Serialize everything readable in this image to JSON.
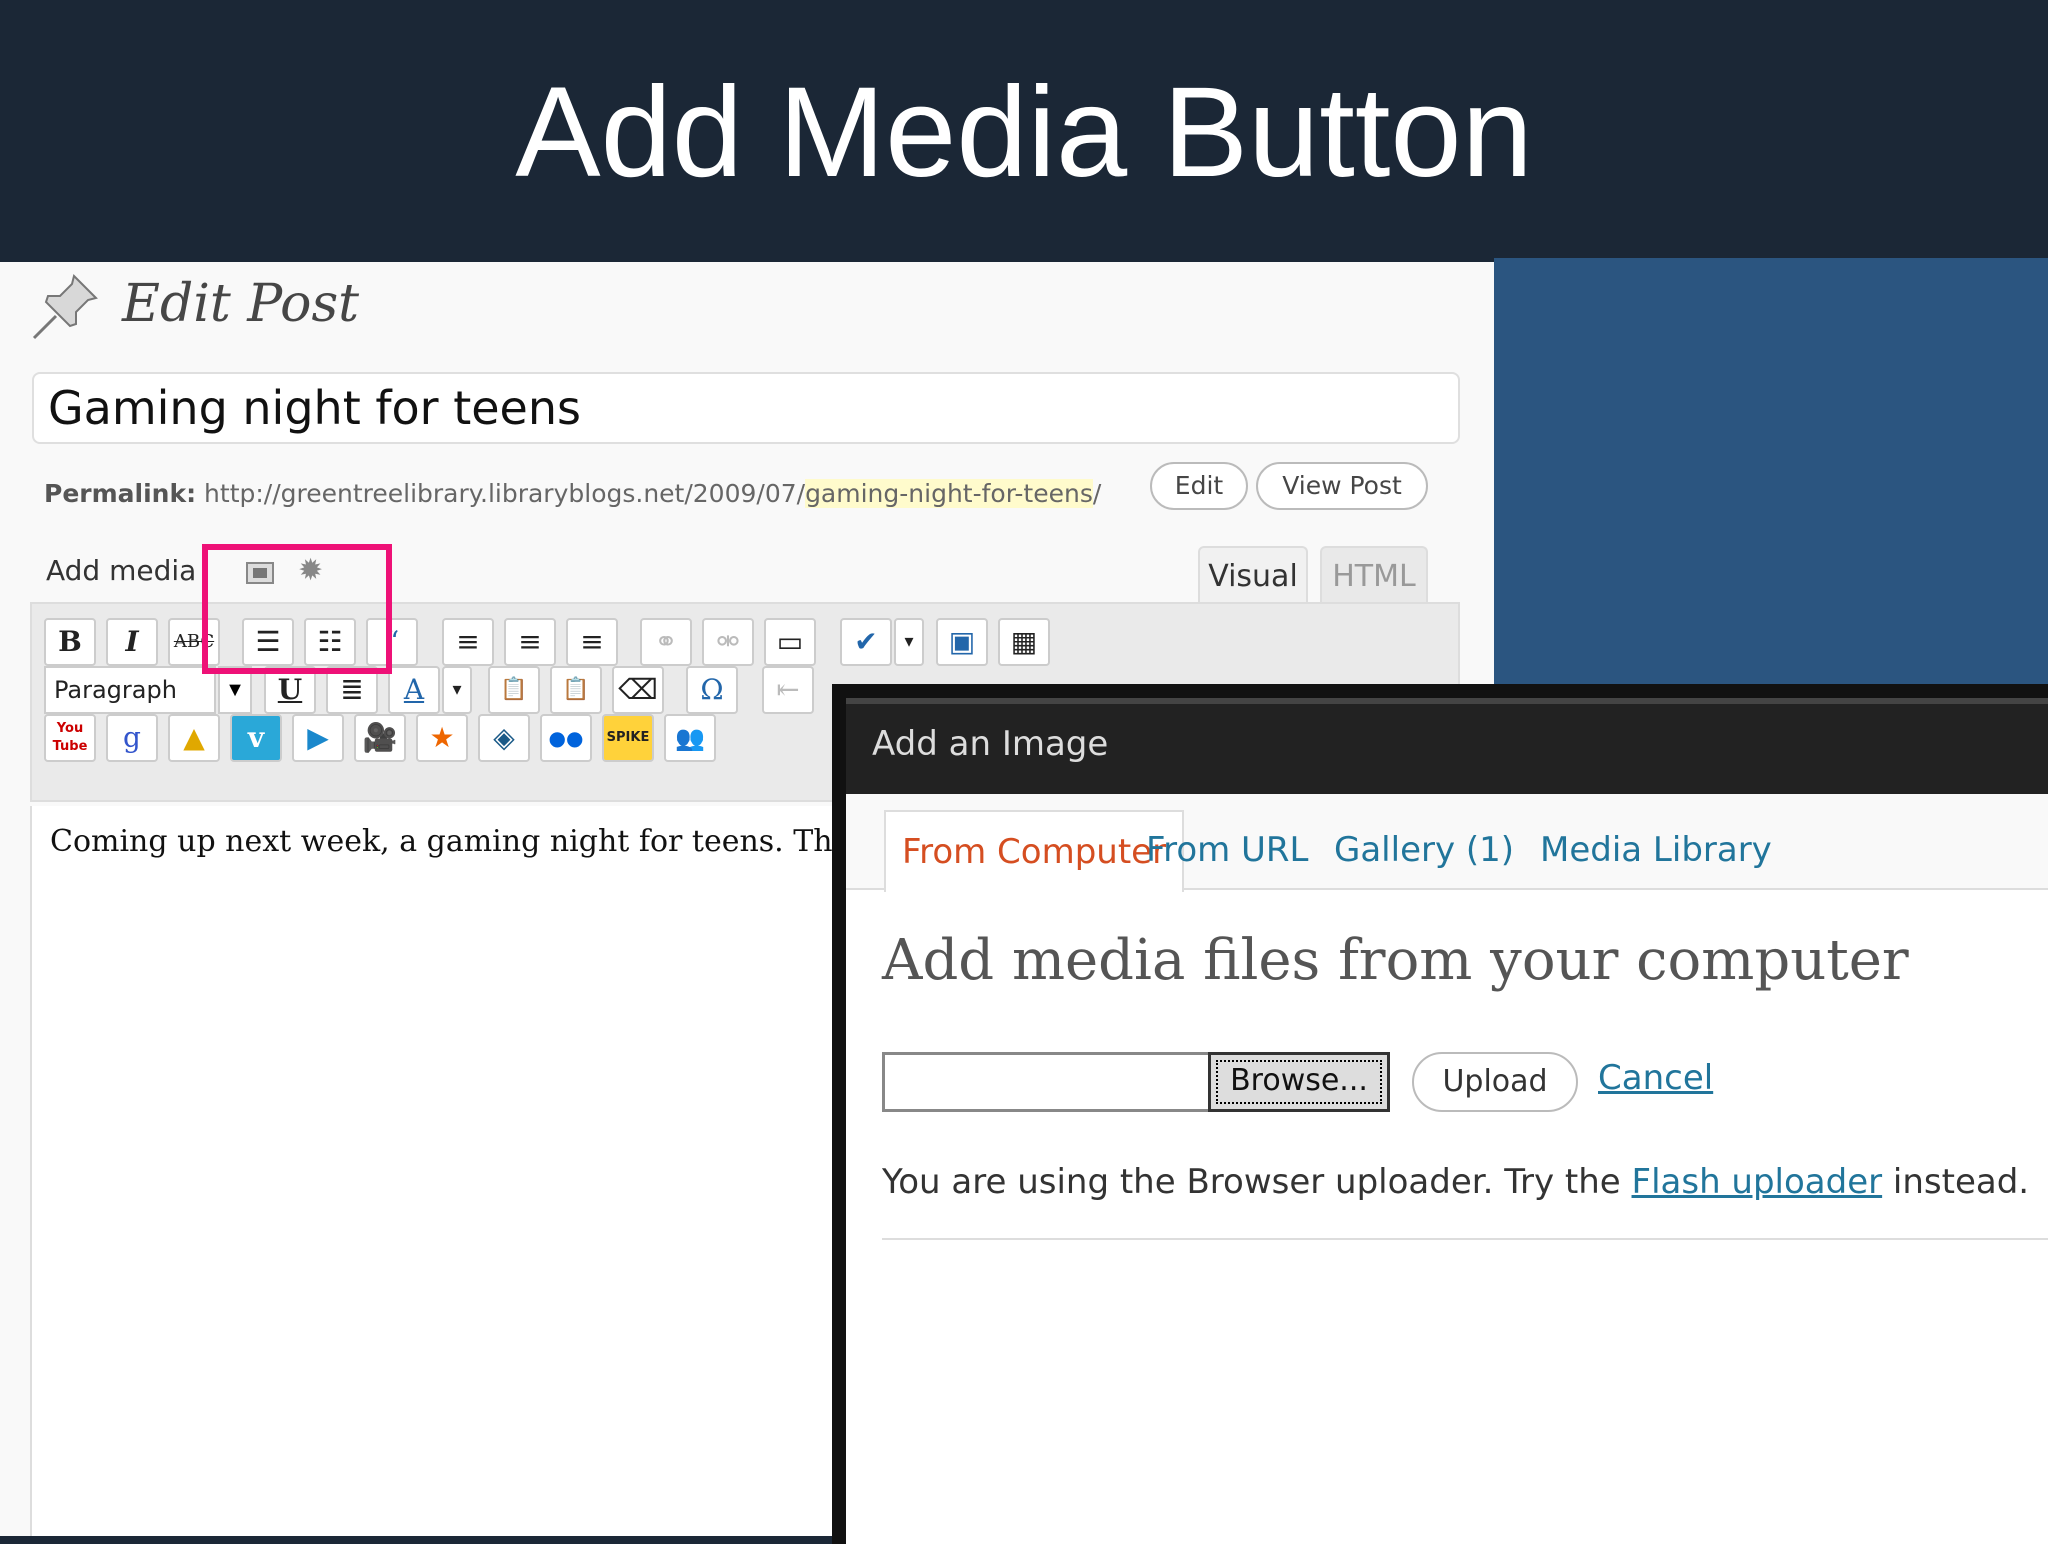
{
  "slide": {
    "title": "Add Media Button"
  },
  "editor": {
    "heading": "Edit Post",
    "post_title": "Gaming night for teens",
    "permalink_label": "Permalink:",
    "permalink_base": "http://greentreelibrary.libraryblogs.net/2009/07/",
    "permalink_slug": "gaming-night-for-teens",
    "permalink_end": "/",
    "edit_button": "Edit",
    "view_post_button": "View Post",
    "add_media_label": "Add media",
    "tab_visual": "Visual",
    "tab_html": "HTML",
    "format_select": "Paragraph",
    "body_text": "Coming up next week, a gaming night for teens. Thursday",
    "toolbar_row1": [
      "B",
      "I",
      "ABC",
      "☰",
      "☷",
      "“",
      "≡",
      "≡",
      "≡",
      "⚭",
      "⚮",
      "▭",
      "✔",
      "▾",
      "▣",
      "▦"
    ],
    "toolbar_row2": [
      "U",
      "≣",
      "A",
      "▾",
      "📋",
      "📋",
      "⌫",
      "Ω",
      "⇤"
    ],
    "toolbar_row3": [
      "You Tube",
      "g",
      "▲",
      "v",
      "▶",
      "🎥",
      "★",
      "◈",
      "●●",
      "SPIKE",
      "👥"
    ]
  },
  "dialog": {
    "title": "Add an Image",
    "tabs": [
      "From Computer",
      "From URL",
      "Gallery (1)",
      "Media Library"
    ],
    "heading": "Add media files from your computer",
    "browse_button": "Browse...",
    "upload_button": "Upload",
    "cancel_link": "Cancel",
    "note_prefix": "You are using the Browser uploader. Try the ",
    "note_link": "Flash uploader",
    "note_suffix": " instead."
  },
  "colors": {
    "header_bg": "#1b2736",
    "right_panel": "#2b5580",
    "highlight": "#ee1177",
    "link": "#21759b",
    "active_tab": "#d54e21"
  }
}
